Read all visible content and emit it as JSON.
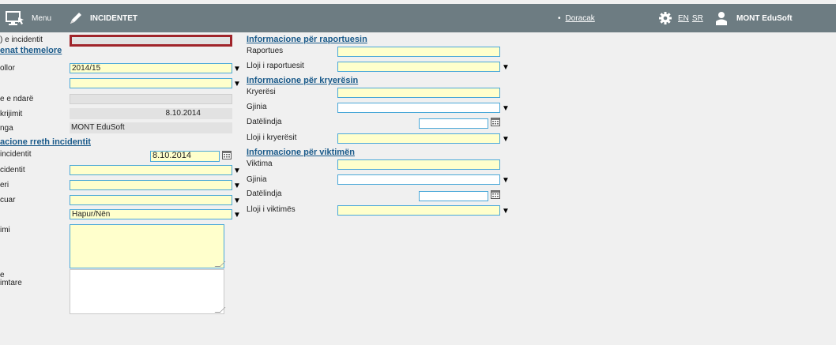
{
  "header": {
    "menu_label": "Menu",
    "module_title": "INCIDENTET",
    "manual_link": "Doracak",
    "lang_en": "EN",
    "lang_sr": "SR",
    "user_name": "MONT EduSoft"
  },
  "left": {
    "incident_id_label": ") e incidentit",
    "section_basic": "enat themelore",
    "school_year_label": "ollor",
    "school_year_value": "2014/15",
    "divided_label": "e e ndarë",
    "created_label": "krijimit",
    "created_value": "8.10.2014",
    "from_label": "nga",
    "from_value": "MONT EduSoft",
    "section_incident": "acione rreth incidentit",
    "incident_date_label": "incidentit",
    "incident_date_value": "8.10.2014",
    "incident_type_label": "cidentit",
    "field_eri_label": "eri",
    "field_cuar_label": "cuar",
    "status_value": "Hapur/Nën",
    "description_label": "imi",
    "details_label_1": "e",
    "details_label_2": "imtare"
  },
  "reporter": {
    "section": "Informacione për raportuesin",
    "name_label": "Raportues",
    "type_label": "Lloji i raportuesit"
  },
  "perpetrator": {
    "section": "Informacione për kryerësin",
    "name_label": "Kryerësi",
    "gender_label": "Gjinia",
    "birth_label": "Datëlindja",
    "type_label": "Lloji i kryerësit"
  },
  "victim": {
    "section": "Informacione për viktimën",
    "name_label": "Viktima",
    "gender_label": "Gjinia",
    "birth_label": "Datëlindja",
    "type_label": "Lloji i viktimës"
  },
  "icons": {
    "dropdown": "▼",
    "bullet": "•"
  },
  "colors": {
    "topbar": "#6d7c82",
    "field_yellow": "#ffffcc",
    "field_border": "#4aa8d8",
    "required_border": "#a0242a",
    "section_text": "#1a5a8a"
  }
}
